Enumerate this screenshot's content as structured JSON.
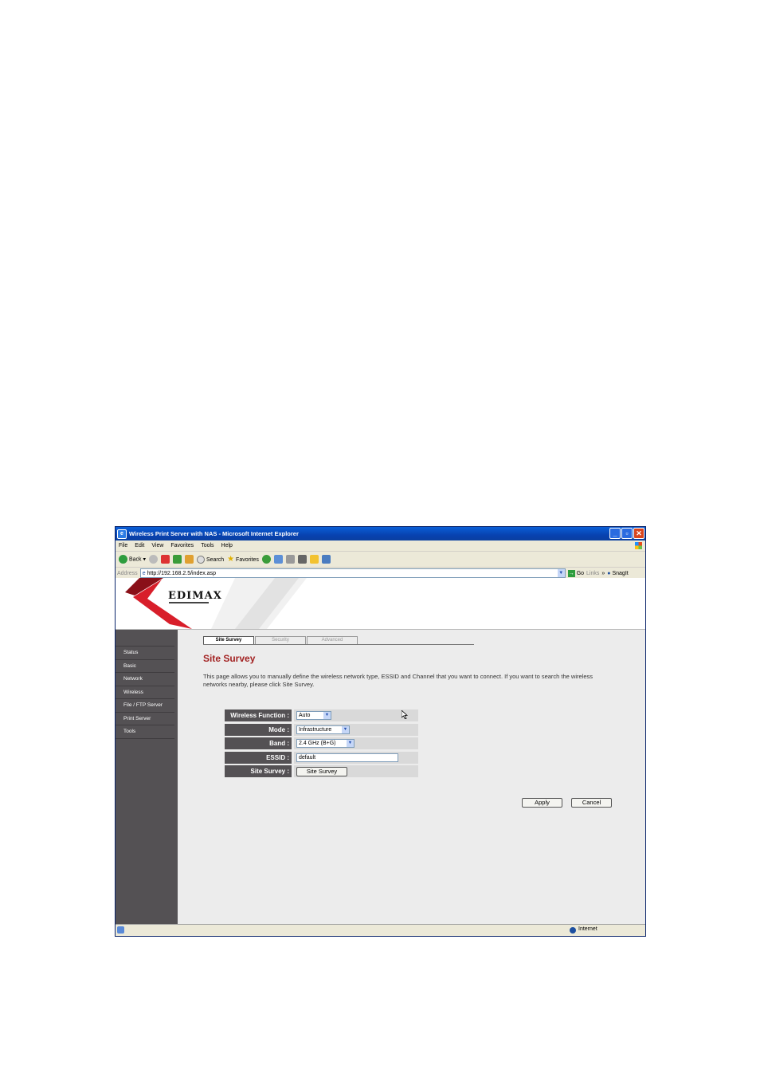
{
  "window": {
    "title": "Wireless Print Server with NAS - Microsoft Internet Explorer"
  },
  "menu": [
    "File",
    "Edit",
    "View",
    "Favorites",
    "Tools",
    "Help"
  ],
  "toolbar": {
    "back": "Back",
    "search": "Search",
    "favorites": "Favorites"
  },
  "address": {
    "label": "Address",
    "url": "http://192.168.2.5/index.asp",
    "go": "Go",
    "links": "Links",
    "snagit": "SnagIt"
  },
  "brand": {
    "logo": "EDIMAX"
  },
  "sidebar": {
    "items": [
      "Status",
      "Basic",
      "Network",
      "Wireless",
      "File / FTP Server",
      "Print Server",
      "Tools"
    ]
  },
  "tabs": [
    "Site Survey",
    "Security",
    "Advanced"
  ],
  "page": {
    "heading": "Site Survey",
    "description": "This page allows you to manually define the wireless network type, ESSID and Channel that you want to connect. If you want to search the wireless networks nearby, please click Site Survey."
  },
  "form": {
    "wireless_function": {
      "label": "Wireless Function :",
      "value": "Auto"
    },
    "mode": {
      "label": "Mode :",
      "value": "Infrastructure"
    },
    "band": {
      "label": "Band :",
      "value": "2.4 GHz (B+G)"
    },
    "essid": {
      "label": "ESSID :",
      "value": "default"
    },
    "site_survey": {
      "label": "Site Survey :",
      "button": "Site Survey"
    }
  },
  "actions": {
    "apply": "Apply",
    "cancel": "Cancel"
  },
  "status": {
    "zone": "Internet"
  },
  "colors": {
    "titlebar": "#0842b0",
    "heading": "#a32323",
    "sidebar": "#545154",
    "brand_red": "#d81e2a"
  }
}
